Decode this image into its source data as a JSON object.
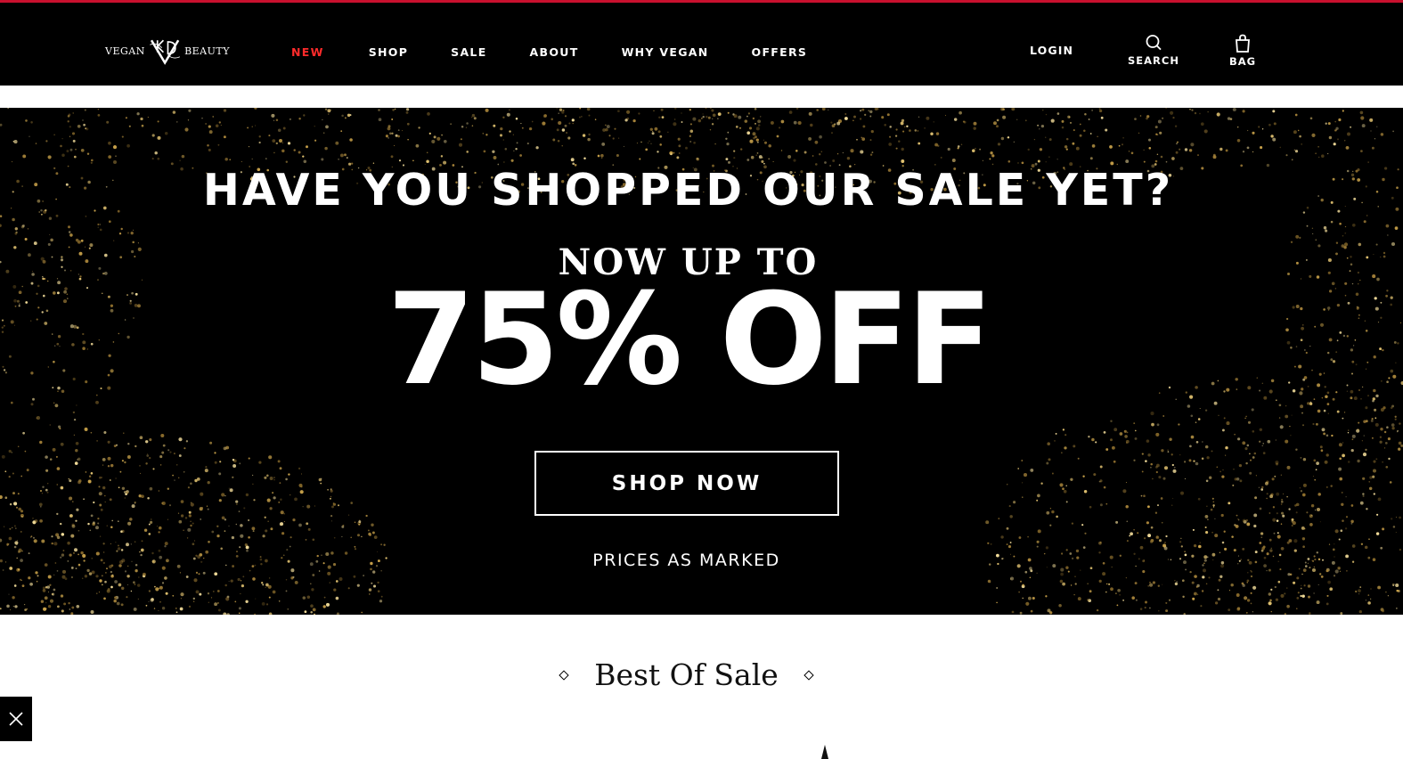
{
  "brand": {
    "word_left": "VEGAN",
    "monogram": "KVD",
    "word_right": "BEAUTY"
  },
  "nav": {
    "items": [
      {
        "label": "NEW",
        "accent": true
      },
      {
        "label": "SHOP",
        "accent": false
      },
      {
        "label": "SALE",
        "accent": false
      },
      {
        "label": "ABOUT",
        "accent": false
      },
      {
        "label": "WHY VEGAN",
        "accent": false
      },
      {
        "label": "OFFERS",
        "accent": false
      }
    ],
    "login": "LOGIN",
    "search_label": "SEARCH",
    "search_icon": "search-icon",
    "bag_label": "BAG",
    "bag_icon": "bag-icon"
  },
  "hero": {
    "headline": "HAVE YOU SHOPPED OUR SALE YET?",
    "sub": "NOW UP TO",
    "big": "75% OFF",
    "cta": "SHOP NOW",
    "note": "PRICES AS MARKED"
  },
  "section": {
    "title": "Best Of Sale"
  },
  "colors": {
    "accent": "#c8102e",
    "nav_new": "#ff2b2b",
    "header_bg": "#000000",
    "gold": "#c9a24a"
  },
  "close_icon": "close-icon"
}
